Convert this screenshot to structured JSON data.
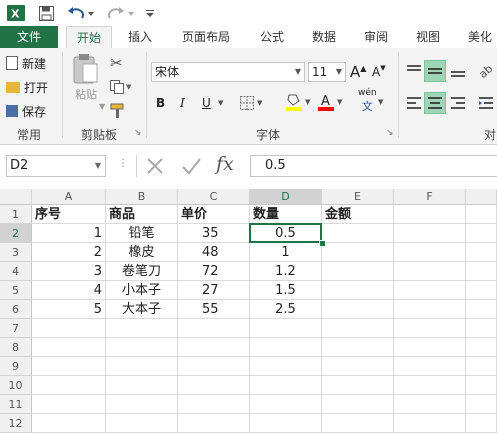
{
  "quick_access": {
    "app_icon": "excel-icon",
    "save_icon": "save-icon",
    "undo_icon": "undo-icon",
    "redo_icon": "redo-icon",
    "customize_icon": "chevron-down-icon"
  },
  "tabs": [
    "文件",
    "开始",
    "插入",
    "页面布局",
    "公式",
    "数据",
    "审阅",
    "视图",
    "美化"
  ],
  "active_tab": "开始",
  "ribbon": {
    "common": {
      "new": "新建",
      "open": "打开",
      "save": "保存",
      "label": "常用"
    },
    "clipboard": {
      "paste": "粘贴",
      "label": "剪贴板"
    },
    "font": {
      "name": "宋体",
      "size": "11",
      "grow": "A",
      "shrink": "A",
      "bold": "B",
      "italic": "I",
      "underline": "U",
      "phonetic": "wén",
      "label": "字体",
      "highlight_color": "#ffff00",
      "font_color": "#ff0000"
    },
    "align_label": "对"
  },
  "formula_bar": {
    "name_box": "D2",
    "fx": "fx",
    "value": "0.5"
  },
  "columns": [
    "A",
    "B",
    "C",
    "D",
    "E",
    "F"
  ],
  "rows": [
    "1",
    "2",
    "3",
    "4",
    "5",
    "6",
    "7",
    "8",
    "9",
    "10",
    "11",
    "12"
  ],
  "selected_cell": "D2",
  "sheet": {
    "header": [
      "序号",
      "商品",
      "单价",
      "数量",
      "金额"
    ],
    "data": [
      [
        "1",
        "铅笔",
        "35",
        "0.5"
      ],
      [
        "2",
        "橡皮",
        "48",
        "1"
      ],
      [
        "3",
        "卷笔刀",
        "72",
        "1.2"
      ],
      [
        "4",
        "小本子",
        "27",
        "1.5"
      ],
      [
        "5",
        "大本子",
        "55",
        "2.5"
      ]
    ]
  },
  "colors": {
    "excel_green": "#217346",
    "selection": "#217346"
  }
}
